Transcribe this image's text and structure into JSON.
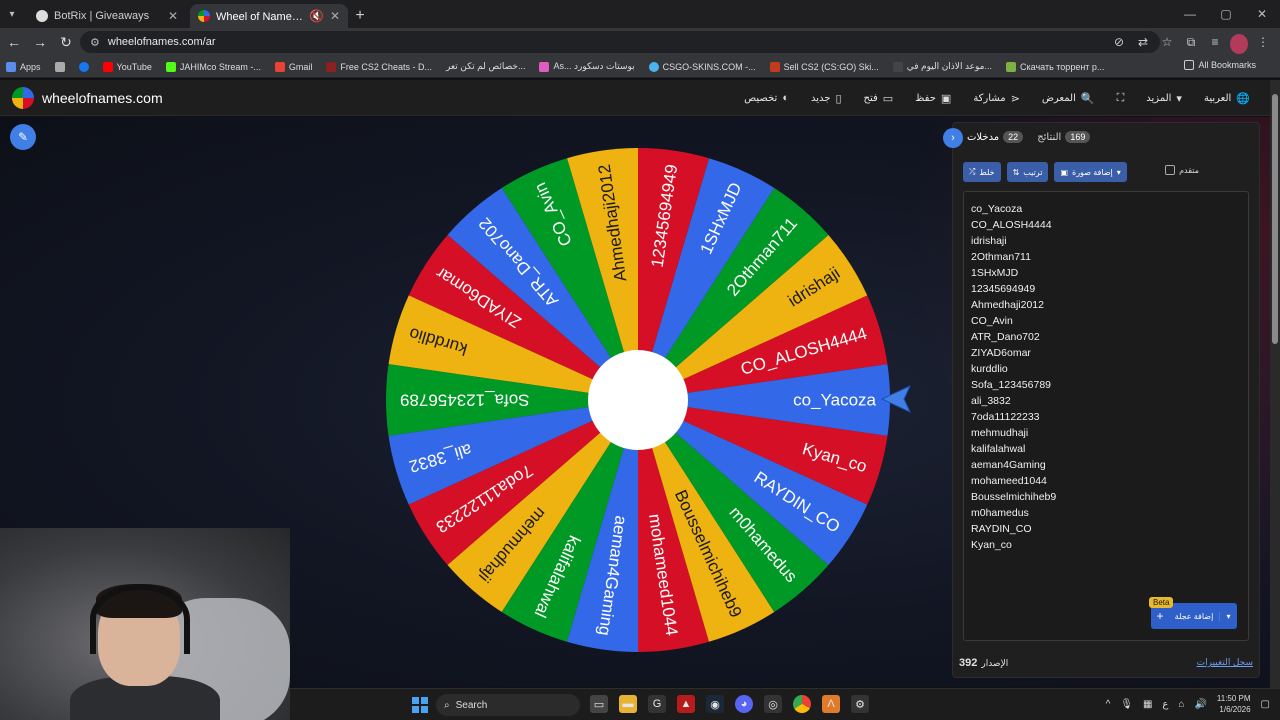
{
  "browser": {
    "tabs": [
      {
        "title": "BotRix | Giveaways",
        "active": false
      },
      {
        "title": "Wheel of Names | العشوائي",
        "active": true
      }
    ],
    "url": "wheelofnames.com/ar",
    "bookmarks": [
      "Apps",
      "YouTube",
      "JAHIMco Stream -...",
      "Gmail",
      "Free CS2 Cheats - D...",
      "خصائص لم تكن تعر...",
      "As... بوستات دسكورد",
      "CSGO-SKINS.COM -...",
      "Sell CS2 (CS:GO) Ski...",
      "موعد الاذان اليوم في...",
      "Скачать торрент р..."
    ],
    "all_bookmarks": "All Bookmarks"
  },
  "site": {
    "name": "wheelofnames.com",
    "menu": [
      {
        "label": "تخصيص",
        "icon": "palette-icon"
      },
      {
        "label": "جديد",
        "icon": "file-icon"
      },
      {
        "label": "فتح",
        "icon": "folder-icon"
      },
      {
        "label": "حفظ",
        "icon": "save-icon"
      },
      {
        "label": "مشاركة",
        "icon": "share-icon"
      },
      {
        "label": "المعرض",
        "icon": "search-icon"
      },
      {
        "label": "",
        "icon": "fullscreen-icon"
      },
      {
        "label": "المزيد",
        "icon": "more-icon"
      },
      {
        "label": "العربية",
        "icon": "globe-icon"
      }
    ]
  },
  "wheel": {
    "colors": [
      "#3369e8",
      "#d50f25",
      "#eeb211",
      "#009925"
    ],
    "pointer_color": "#3f7fe6"
  },
  "panel": {
    "tab_entries": "مدخلات",
    "entries_count": "22",
    "tab_results": "النتائج",
    "results_count": "169",
    "btn_shuffle": "خلط",
    "btn_sort": "ترتيب",
    "btn_add_image": "إضافة صورة",
    "advanced_label": "متقدم",
    "entries": [
      "co_Yacoza",
      "CO_ALOSH4444",
      "idrishaji",
      "2Othman711",
      "1SHxMJD",
      "12345694949",
      "Ahmedhaji2012",
      "CO_Avin",
      "ATR_Dano702",
      "ZIYAD6omar",
      "kurddlio",
      "Sofa_123456789",
      "ali_3832",
      "7oda11122233",
      "mehmudhaji",
      "kalifalahwal",
      "aeman4Gaming",
      "mohameed1044",
      "Bousselmichiheb9",
      "m0hamedus",
      "RAYDIN_CO",
      "Kyan_co"
    ],
    "beta": "Beta",
    "add_wheel": "إضافة عجلة",
    "version_label": "الإصدار",
    "version": "392",
    "changelog": "سجل التغييرات"
  },
  "taskbar": {
    "search": "Search",
    "lang": "ع",
    "time": "11:50 PM",
    "date": "1/6/2026"
  }
}
